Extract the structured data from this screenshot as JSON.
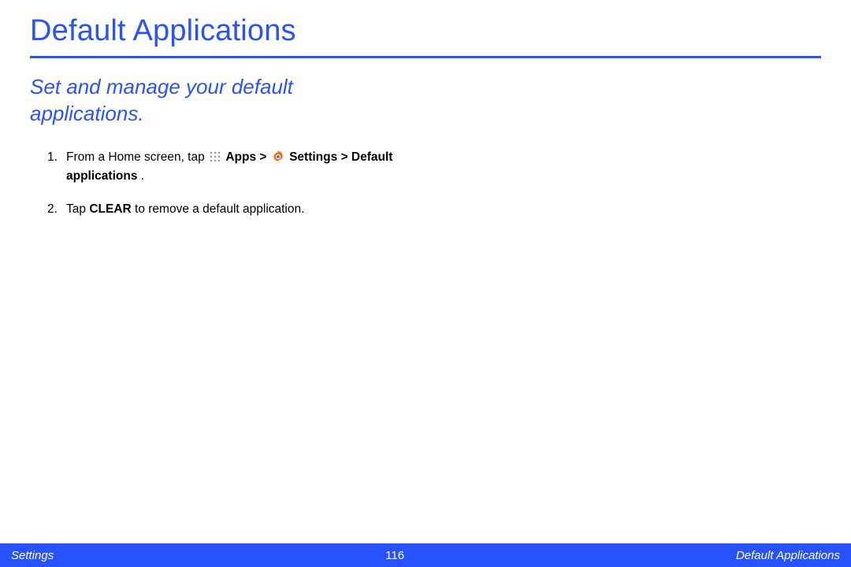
{
  "title": "Default Applications",
  "subtitle": "Set and manage your default applications.",
  "steps": {
    "s1_num": "1.",
    "s1_a": "From a Home screen, tap ",
    "s1_apps": "Apps",
    "s1_gt1": " > ",
    "s1_settings": "Settings",
    "s1_gt2": " > ",
    "s1_default": "Default applications",
    "s1_period": ".",
    "s2_num": "2.",
    "s2_a": "Tap ",
    "s2_clear": "CLEAR",
    "s2_b": " to remove a default application."
  },
  "footer": {
    "left": "Settings",
    "center": "116",
    "right": "Default Applications"
  }
}
